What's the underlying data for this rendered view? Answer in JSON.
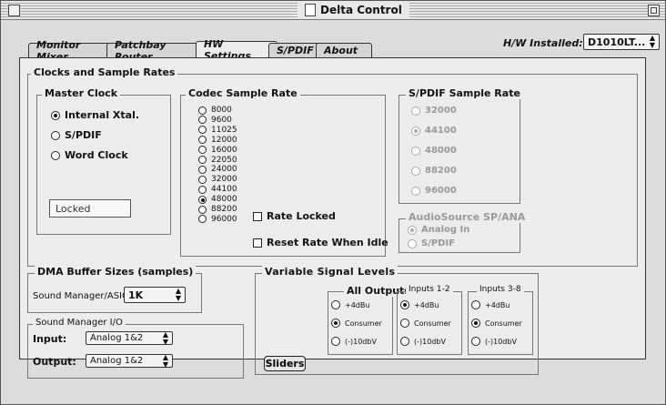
{
  "window": {
    "title": "Delta Control"
  },
  "hw_installed": {
    "label": "H/W Installed:",
    "value": "D1010LT..."
  },
  "tabs": [
    "Monitor Mixer",
    "Patchbay Router",
    "HW Settings",
    "S/PDIF",
    "About"
  ],
  "clocks": {
    "title": "Clocks and Sample Rates",
    "master_clock": {
      "title": "Master Clock",
      "options": [
        "Internal Xtal.",
        "S/PDIF",
        "Word Clock"
      ],
      "selected": "Internal Xtal.",
      "status": "Locked"
    },
    "codec": {
      "title": "Codec Sample Rate",
      "rates": [
        "8000",
        "9600",
        "11025",
        "12000",
        "16000",
        "22050",
        "24000",
        "32000",
        "44100",
        "48000",
        "88200",
        "96000"
      ],
      "selected": "48000",
      "rate_locked": "Rate Locked",
      "reset_rate": "Reset Rate When Idle"
    },
    "spdif": {
      "title": "S/PDIF Sample Rate",
      "rates": [
        "32000",
        "44100",
        "48000",
        "88200",
        "96000"
      ],
      "selected": "44100"
    },
    "audiosource": {
      "title": "AudioSource SP/ANA",
      "options": [
        "Analog In",
        "S/PDIF"
      ],
      "selected": "Analog In"
    }
  },
  "dma": {
    "title": "DMA Buffer Sizes (samples)",
    "label": "Sound Manager/ASIO:",
    "value": "1K"
  },
  "sound_manager_io": {
    "title": "Sound Manager I/O",
    "input_label": "Input:",
    "input_value": "Analog 1&2",
    "output_label": "Output:",
    "output_value": "Analog 1&2"
  },
  "levels": {
    "title": "Variable Signal Levels",
    "groups": [
      {
        "title": "All Outputs",
        "selected": "Consumer"
      },
      {
        "title": "Inputs 1-2",
        "selected": "+4dBu"
      },
      {
        "title": "Inputs 3-8",
        "selected": "Consumer"
      }
    ],
    "options": [
      "+4dBu",
      "Consumer",
      "(-)10dbV"
    ],
    "sliders_button": "Sliders"
  }
}
